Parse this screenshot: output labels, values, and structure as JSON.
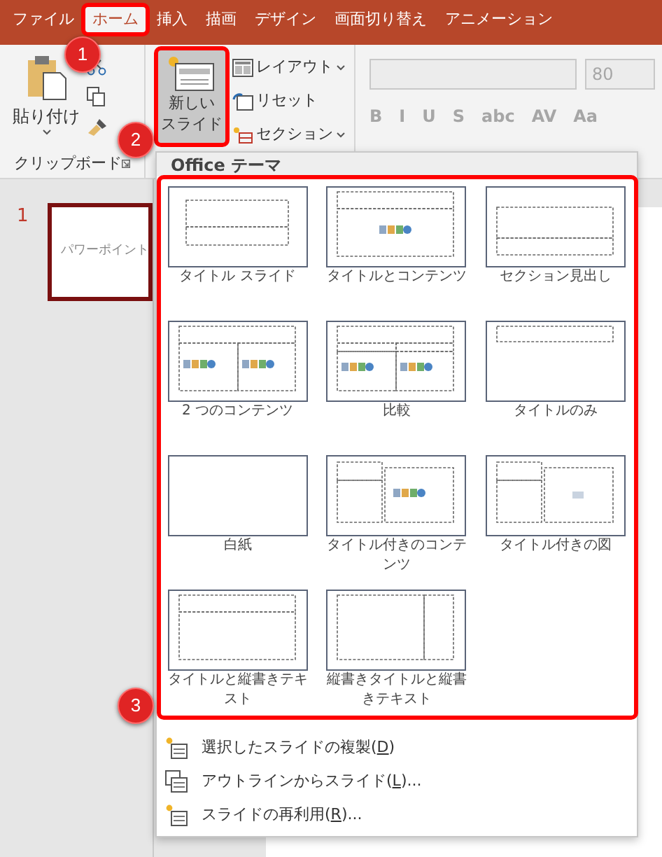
{
  "tabs": [
    {
      "label": "ファイル",
      "selected": false
    },
    {
      "label": "ホーム",
      "selected": true
    },
    {
      "label": "挿入",
      "selected": false
    },
    {
      "label": "描画",
      "selected": false
    },
    {
      "label": "デザイン",
      "selected": false
    },
    {
      "label": "画面切り替え",
      "selected": false
    },
    {
      "label": "アニメーション",
      "selected": false
    }
  ],
  "ribbon": {
    "paste_label": "貼り付け",
    "clipboard_group": "クリップボード",
    "new_slide_lines": [
      "新しい",
      "スライド"
    ],
    "slide_buttons": [
      {
        "label": "レイアウト",
        "kind": "layout",
        "caret": true
      },
      {
        "label": "リセット",
        "kind": "reset",
        "caret": false
      },
      {
        "label": "セクション",
        "kind": "section",
        "caret": true
      }
    ],
    "font_size": "80",
    "font_disabled": true,
    "font_buttons": [
      "B",
      "I",
      "U",
      "S",
      "abc",
      "AV",
      "Aa"
    ]
  },
  "slide_pane": {
    "number": "1",
    "thumbnail_text": "パワーポイント"
  },
  "menu": {
    "header": "Office テーマ",
    "layouts": [
      {
        "label": "タイトル スライド",
        "kind": "title"
      },
      {
        "label": "タイトルとコンテンツ",
        "kind": "title-content"
      },
      {
        "label": "セクション見出し",
        "kind": "section"
      },
      {
        "label": "2 つのコンテンツ",
        "kind": "two-content"
      },
      {
        "label": "比較",
        "kind": "comparison"
      },
      {
        "label": "タイトルのみ",
        "kind": "title-only"
      },
      {
        "label": "白紙",
        "kind": "blank"
      },
      {
        "label": "タイトル付きのコンテンツ",
        "kind": "content-caption"
      },
      {
        "label": "タイトル付きの図",
        "kind": "picture-caption"
      },
      {
        "label": "タイトルと縦書きテキスト",
        "kind": "vertical-text"
      },
      {
        "label": "縦書きタイトルと縦書きテキスト",
        "kind": "vertical-title"
      }
    ],
    "items": [
      {
        "label": "選択したスライドの複製(",
        "accel": "D",
        "after": ")",
        "kind": "duplicate"
      },
      {
        "label": "アウトラインからスライド(",
        "accel": "L",
        "after": ")...",
        "kind": "outline"
      },
      {
        "label": "スライドの再利用(",
        "accel": "R",
        "after": ")...",
        "kind": "reuse"
      }
    ]
  },
  "annotations": [
    {
      "number": "1"
    },
    {
      "number": "2"
    },
    {
      "number": "3"
    }
  ]
}
